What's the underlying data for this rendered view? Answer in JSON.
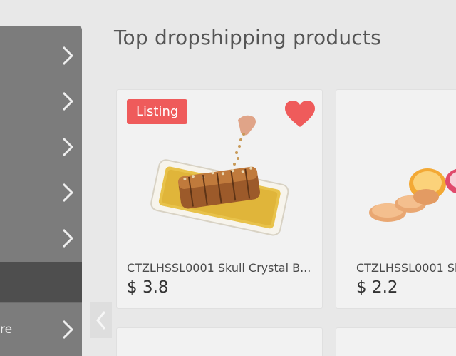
{
  "title": "Top dropshipping products",
  "sidebar": {
    "items": [
      {
        "label": "",
        "icon": "chevron-right-icon"
      },
      {
        "label": "",
        "icon": "chevron-right-icon"
      },
      {
        "label": "",
        "icon": "chevron-right-icon"
      },
      {
        "label": "",
        "icon": "chevron-right-icon"
      },
      {
        "label": "",
        "icon": "chevron-right-icon"
      },
      {
        "label": "",
        "active": true
      },
      {
        "label": "re",
        "icon": "chevron-right-icon"
      }
    ]
  },
  "products": [
    {
      "badge": "Listing",
      "title": "CTZLHSSL0001 Skull Crystal B...",
      "price": "$ 3.8",
      "favorite": true,
      "image": "cake-on-tray"
    },
    {
      "title": "CTZLHSSL0001 Sk",
      "price": "$ 2.2",
      "image": "cookies-and-cupcakes"
    }
  ],
  "colors": {
    "badge": "#ef5b5b",
    "heart": "#ef5b5b",
    "sidebar": "#7c7c7c",
    "sidebar_active": "#4e4e4e"
  }
}
